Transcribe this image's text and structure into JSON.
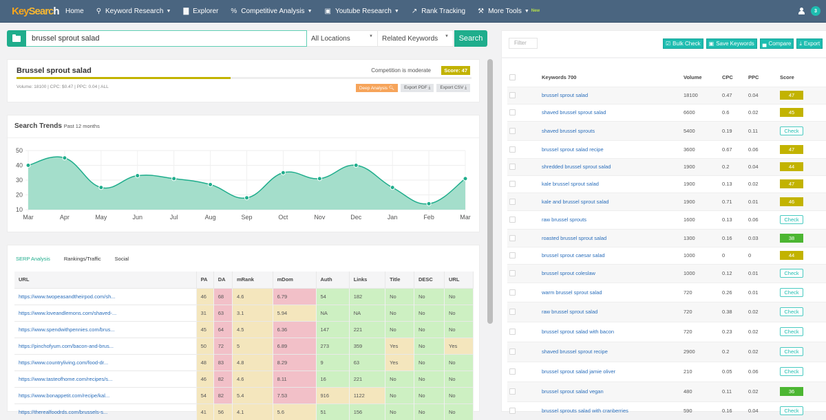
{
  "nav": {
    "logo": {
      "part1": "Key",
      "part2": "Searc",
      "part3": "h"
    },
    "items": [
      {
        "label": "Home",
        "icon": "",
        "caret": false
      },
      {
        "label": "Keyword Research",
        "icon": "search-icon",
        "caret": true
      },
      {
        "label": "Explorer",
        "icon": "bar-chart-icon",
        "caret": false
      },
      {
        "label": "Competitive Analysis",
        "icon": "percent-icon",
        "caret": true
      },
      {
        "label": "Youtube Research",
        "icon": "save-icon",
        "caret": true
      },
      {
        "label": "Rank Tracking",
        "icon": "line-chart-icon",
        "caret": false
      },
      {
        "label": "More Tools",
        "icon": "wrench-icon",
        "caret": true,
        "badge": "New"
      }
    ],
    "notification_count": "3"
  },
  "search": {
    "query": "brussel sprout salad",
    "location": "All Locations",
    "mode": "Related Keywords",
    "button": "Search"
  },
  "summary": {
    "title": "Brussel sprout salad",
    "competition": "Competition is moderate",
    "score_label": "Score: 47",
    "score_value": 47,
    "meta": "Volume: 18100 | CPC: $0.47 | PPC: 0.04 | ALL",
    "buttons": {
      "deep": "Deep Analysis 🔍︎",
      "pdf": "Export PDF ⤓",
      "csv": "Export CSV ⤓"
    }
  },
  "trends": {
    "title": "Search Trends",
    "subtitle": "Past 12 months"
  },
  "chart_data": {
    "type": "area",
    "title": "Search Trends Past 12 months",
    "categories": [
      "Mar",
      "Apr",
      "May",
      "Jun",
      "Jul",
      "Aug",
      "Sep",
      "Oct",
      "Nov",
      "Dec",
      "Jan",
      "Feb",
      "Mar"
    ],
    "values": [
      40,
      45,
      25,
      33,
      31,
      27,
      18,
      35,
      31,
      40,
      25,
      14,
      31
    ],
    "yticks": [
      10,
      20,
      30,
      40,
      50
    ],
    "ylim": [
      10,
      50
    ],
    "grid": true,
    "color": "#1fad8c",
    "fill": "#9fdcc8"
  },
  "serp": {
    "tabs": [
      "SERP Analysis",
      "Rankings/Traffic",
      "Social"
    ],
    "columns": [
      "URL",
      "PA",
      "DA",
      "mRank",
      "mDom",
      "Auth",
      "Links",
      "Title",
      "DESC",
      "URL"
    ],
    "rows": [
      {
        "cells": [
          "https://www.twopeasandtheirpod.com/sh...",
          "46",
          "68",
          "4.6",
          "6.79",
          "54",
          "182",
          "No",
          "No",
          "No"
        ],
        "colors": [
          "",
          "y",
          "r",
          "y",
          "r",
          "g",
          "g",
          "g",
          "g",
          "g"
        ]
      },
      {
        "cells": [
          "https://www.loveandlemons.com/shaved-...",
          "31",
          "63",
          "3.1",
          "5.94",
          "NA",
          "NA",
          "No",
          "No",
          "No"
        ],
        "colors": [
          "",
          "y",
          "r",
          "y",
          "y",
          "g",
          "g",
          "g",
          "g",
          "g"
        ]
      },
      {
        "cells": [
          "https://www.spendwithpennies.com/brus...",
          "45",
          "64",
          "4.5",
          "6.36",
          "147",
          "221",
          "No",
          "No",
          "No"
        ],
        "colors": [
          "",
          "y",
          "r",
          "y",
          "r",
          "g",
          "g",
          "g",
          "g",
          "g"
        ]
      },
      {
        "cells": [
          "https://pinchofyum.com/bacon-and-brus...",
          "50",
          "72",
          "5",
          "6.89",
          "273",
          "359",
          "Yes",
          "No",
          "Yes"
        ],
        "colors": [
          "",
          "y",
          "r",
          "y",
          "r",
          "g",
          "g",
          "y",
          "g",
          "y"
        ]
      },
      {
        "cells": [
          "https://www.countryliving.com/food-dr...",
          "48",
          "83",
          "4.8",
          "8.29",
          "9",
          "63",
          "Yes",
          "No",
          "No"
        ],
        "colors": [
          "",
          "y",
          "r",
          "y",
          "r",
          "g",
          "g",
          "y",
          "g",
          "g"
        ]
      },
      {
        "cells": [
          "https://www.tasteofhome.com/recipes/s...",
          "46",
          "82",
          "4.6",
          "8.11",
          "16",
          "221",
          "No",
          "No",
          "No"
        ],
        "colors": [
          "",
          "y",
          "r",
          "y",
          "r",
          "g",
          "g",
          "g",
          "g",
          "g"
        ]
      },
      {
        "cells": [
          "https://www.bonappetit.com/recipe/kal...",
          "54",
          "82",
          "5.4",
          "7.53",
          "916",
          "1122",
          "No",
          "No",
          "No"
        ],
        "colors": [
          "",
          "y",
          "r",
          "y",
          "r",
          "y",
          "y",
          "g",
          "g",
          "g"
        ]
      },
      {
        "cells": [
          "https://therealfoodrds.com/brussels-s...",
          "41",
          "56",
          "4.1",
          "5.6",
          "51",
          "156",
          "No",
          "No",
          "No"
        ],
        "colors": [
          "",
          "y",
          "y",
          "y",
          "y",
          "g",
          "g",
          "g",
          "g",
          "g"
        ]
      }
    ]
  },
  "keywords": {
    "filter_placeholder": "Filter",
    "toolbar": [
      {
        "label": "Bulk Check",
        "icon": "check-square-icon",
        "glyph": "☑"
      },
      {
        "label": "Save Keywords",
        "icon": "save-icon",
        "glyph": "▣"
      },
      {
        "label": "Compare",
        "icon": "bar-chart-icon",
        "glyph": "▄"
      },
      {
        "label": "Export",
        "icon": "download-icon",
        "glyph": "⤓"
      }
    ],
    "columns": [
      "Keywords 700",
      "Volume",
      "CPC",
      "PPC",
      "Score"
    ],
    "rows": [
      {
        "keyword": "brussel sprout salad",
        "volume": "18100",
        "cpc": "0.47",
        "ppc": "0.04",
        "score": "47",
        "type": "y"
      },
      {
        "keyword": "shaved brussel sprout salad",
        "volume": "6600",
        "cpc": "0.6",
        "ppc": "0.02",
        "score": "45",
        "type": "y"
      },
      {
        "keyword": "shaved brussel sprouts",
        "volume": "5400",
        "cpc": "0.19",
        "ppc": "0.11",
        "score": "Check",
        "type": "check"
      },
      {
        "keyword": "brussel sprout salad recipe",
        "volume": "3600",
        "cpc": "0.67",
        "ppc": "0.06",
        "score": "47",
        "type": "y"
      },
      {
        "keyword": "shredded brussel sprout salad",
        "volume": "1900",
        "cpc": "0.2",
        "ppc": "0.04",
        "score": "44",
        "type": "y"
      },
      {
        "keyword": "kale brussel sprout salad",
        "volume": "1900",
        "cpc": "0.13",
        "ppc": "0.02",
        "score": "47",
        "type": "y"
      },
      {
        "keyword": "kale and brussel sprout salad",
        "volume": "1900",
        "cpc": "0.71",
        "ppc": "0.01",
        "score": "46",
        "type": "y"
      },
      {
        "keyword": "raw brussel sprouts",
        "volume": "1600",
        "cpc": "0.13",
        "ppc": "0.06",
        "score": "Check",
        "type": "check"
      },
      {
        "keyword": "roasted brussel sprout salad",
        "volume": "1300",
        "cpc": "0.16",
        "ppc": "0.03",
        "score": "38",
        "type": "g"
      },
      {
        "keyword": "brussel sprout caesar salad",
        "volume": "1000",
        "cpc": "0",
        "ppc": "0",
        "score": "44",
        "type": "y"
      },
      {
        "keyword": "brussel sprout coleslaw",
        "volume": "1000",
        "cpc": "0.12",
        "ppc": "0.01",
        "score": "Check",
        "type": "check"
      },
      {
        "keyword": "warm brussel sprout salad",
        "volume": "720",
        "cpc": "0.26",
        "ppc": "0.01",
        "score": "Check",
        "type": "check"
      },
      {
        "keyword": "raw brussel sprout salad",
        "volume": "720",
        "cpc": "0.38",
        "ppc": "0.02",
        "score": "Check",
        "type": "check"
      },
      {
        "keyword": "brussel sprout salad with bacon",
        "volume": "720",
        "cpc": "0.23",
        "ppc": "0.02",
        "score": "Check",
        "type": "check"
      },
      {
        "keyword": "shaved brussel sprout recipe",
        "volume": "2900",
        "cpc": "0.2",
        "ppc": "0.02",
        "score": "Check",
        "type": "check"
      },
      {
        "keyword": "brussel sprout salad jamie oliver",
        "volume": "210",
        "cpc": "0.05",
        "ppc": "0.06",
        "score": "Check",
        "type": "check"
      },
      {
        "keyword": "brussel sprout salad vegan",
        "volume": "480",
        "cpc": "0.11",
        "ppc": "0.02",
        "score": "36",
        "type": "g"
      },
      {
        "keyword": "brussel sprouts salad with cranberries",
        "volume": "590",
        "cpc": "0.16",
        "ppc": "0.04",
        "score": "Check",
        "type": "check"
      }
    ]
  }
}
